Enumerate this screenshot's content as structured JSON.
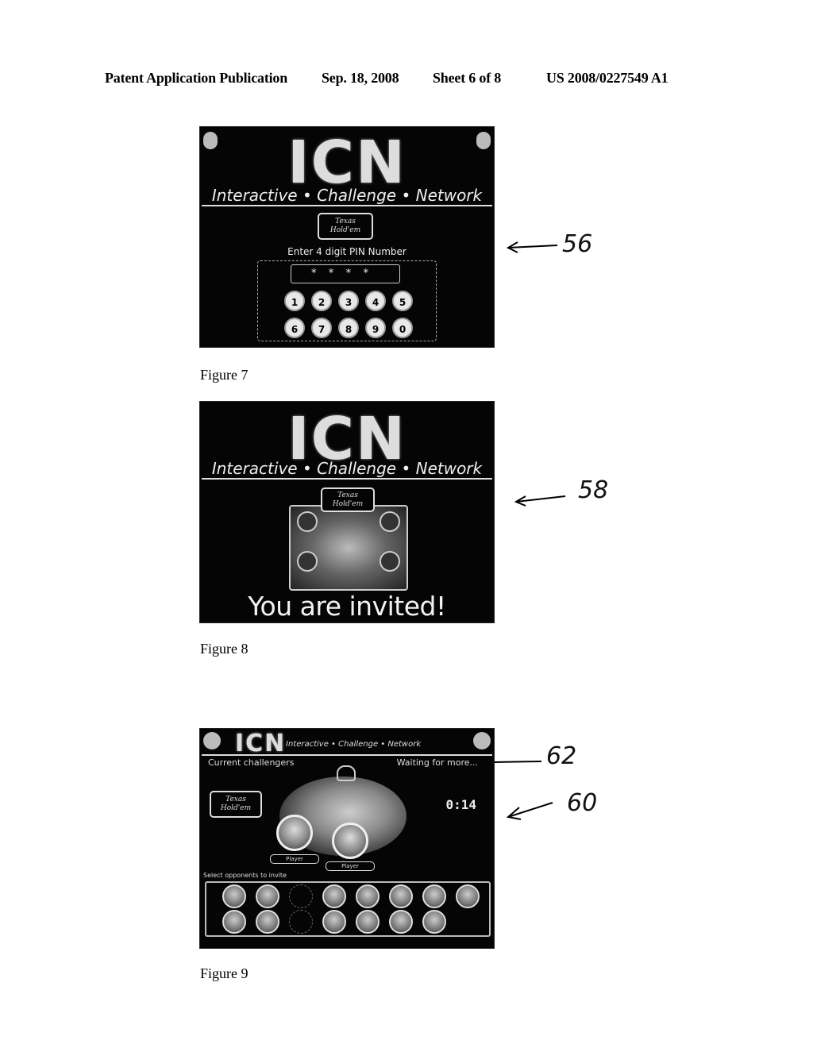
{
  "header": {
    "publication": "Patent Application Publication",
    "date": "Sep. 18, 2008",
    "sheet": "Sheet 6 of 8",
    "number": "US 2008/0227549 A1"
  },
  "brand": {
    "logo": "ICN",
    "tagline": "Interactive • Challenge • Network",
    "badge_text": "Texas Hold'em"
  },
  "figure7": {
    "caption": "Figure 7",
    "reference": "56",
    "pin_prompt": "Enter 4 digit PIN Number",
    "pin_value": "****",
    "keys": [
      "1",
      "2",
      "3",
      "4",
      "5",
      "6",
      "7",
      "8",
      "9",
      "0"
    ]
  },
  "figure8": {
    "caption": "Figure 8",
    "reference": "58",
    "message": "You are invited!"
  },
  "figure9": {
    "caption": "Figure 9",
    "reference_top": "62",
    "reference_bottom": "60",
    "top_left_text": "Current challengers",
    "top_right_text": "Waiting for more...",
    "timer": "0:14",
    "players": [
      "Player",
      "Player"
    ],
    "roster_label": "Select opponents to invite",
    "roster_rows": [
      [
        true,
        true,
        false,
        true,
        true,
        true,
        true,
        true
      ],
      [
        true,
        true,
        false,
        true,
        true,
        true,
        true,
        false
      ]
    ]
  },
  "colors": {
    "screen_bg": "#050505",
    "screen_fg": "#e8e8e8",
    "page_bg": "#ffffff"
  }
}
